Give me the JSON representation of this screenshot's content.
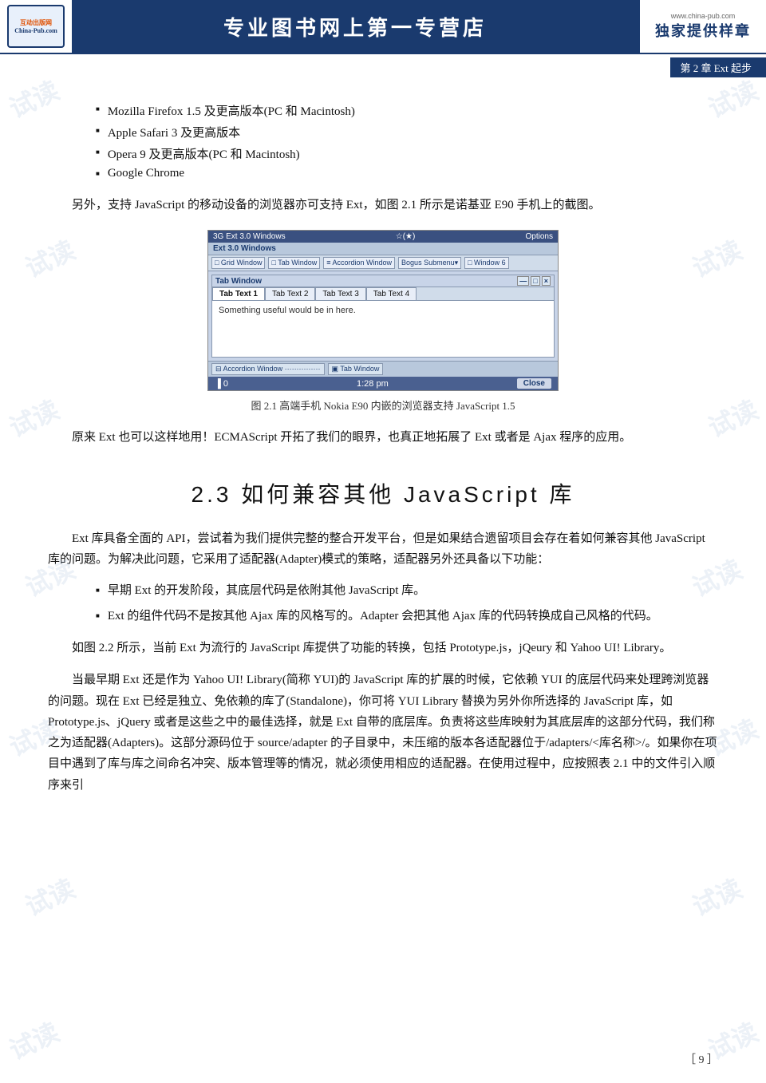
{
  "header": {
    "logo_top": "互动出版网",
    "logo_bottom": "China-Pub.com",
    "url": "www.china-pub.com",
    "title": "专业图书网上第一专营店",
    "exclusive": "独家提供样章"
  },
  "chapter_tag": "第 2 章   Ext 起步",
  "bullet_items": [
    "Mozilla Firefox 1.5 及更高版本(PC 和 Macintosh)",
    "Apple Safari 3 及更高版本",
    "Opera 9 及更高版本(PC 和 Macintosh)",
    "Google Chrome"
  ],
  "paragraph1": "另外，支持 JavaScript 的移动设备的浏览器亦可支持 Ext，如图 2.1 所示是诺基亚 E90 手机上的截图。",
  "screenshot": {
    "statusbar_left": "3G Ext 3.0 Windows",
    "statusbar_right_icon": "☆(★)",
    "options_btn": "Options",
    "nav_title": "Ext 3.0 Windows",
    "toolbar_items": [
      "Grid Window",
      "Tab Window",
      "Accordion Window",
      "Bogus Submenu▼",
      "Window 6"
    ],
    "tab_window_title": "Tab Window",
    "win_controls": [
      "-",
      "□",
      "×"
    ],
    "tab_items": [
      "Tab Text 1",
      "Tab Text 2",
      "Tab Text 3",
      "Tab Text 4"
    ],
    "tab_content": "Something useful would be in here.",
    "accordion_items": [
      "Accordion Window",
      "Tab Window"
    ],
    "bottom_left": "▐ 0",
    "bottom_time": "1:28 pm",
    "bottom_close": "Close"
  },
  "fig_caption": "图 2.1    高端手机 Nokia E90 内嵌的浏览器支持 JavaScript 1.5",
  "paragraph2": "原来 Ext 也可以这样地用！ECMAScript 开拓了我们的眼界，也真正地拓展了 Ext 或者是 Ajax 程序的应用。",
  "section_heading": "2.3    如何兼容其他 JavaScript 库",
  "paragraph3": "Ext 库具备全面的 API，尝试着为我们提供完整的整合开发平台，但是如果结合遗留项目会存在着如何兼容其他 JavaScript 库的问题。为解决此问题，它采用了适配器(Adapter)模式的策略，适配器另外还具备以下功能：",
  "inner_bullets": [
    "早期 Ext 的开发阶段，其底层代码是依附其他 JavaScript 库。",
    "Ext 的组件代码不是按其他 Ajax 库的风格写的。Adapter 会把其他 Ajax 库的代码转换成自己风格的代码。"
  ],
  "paragraph4": "如图 2.2 所示，当前 Ext 为流行的 JavaScript 库提供了功能的转换，包括 Prototype.js，jQeury 和 Yahoo UI! Library。",
  "paragraph5": "当最早期 Ext 还是作为 Yahoo UI! Library(简称 YUI)的 JavaScript 库的扩展的时候，它依赖 YUI 的底层代码来处理跨浏览器的问题。现在 Ext 已经是独立、免依赖的库了(Standalone)，你可将 YUI Library 替换为另外你所选择的 JavaScript 库，如 Prototype.js、jQuery 或者是这些之中的最佳选择，就是 Ext 自带的底层库。负责将这些库映射为其底层库的这部分代码，我们称之为适配器(Adapters)。这部分源码位于 source/adapter 的子目录中，未压缩的版本各适配器位于/adapters/<库名称>/。如果你在项目中遇到了库与库之间命名冲突、版本管理等的情况，就必须使用相应的适配器。在使用过程中，应按照表 2.1 中的文件引入顺序来引",
  "page_number": "［ 9 ］",
  "watermarks": [
    "试读",
    "试读",
    "试读",
    "试读",
    "试读",
    "试读",
    "试读",
    "试读",
    "试读",
    "试读",
    "试读",
    "试读"
  ]
}
